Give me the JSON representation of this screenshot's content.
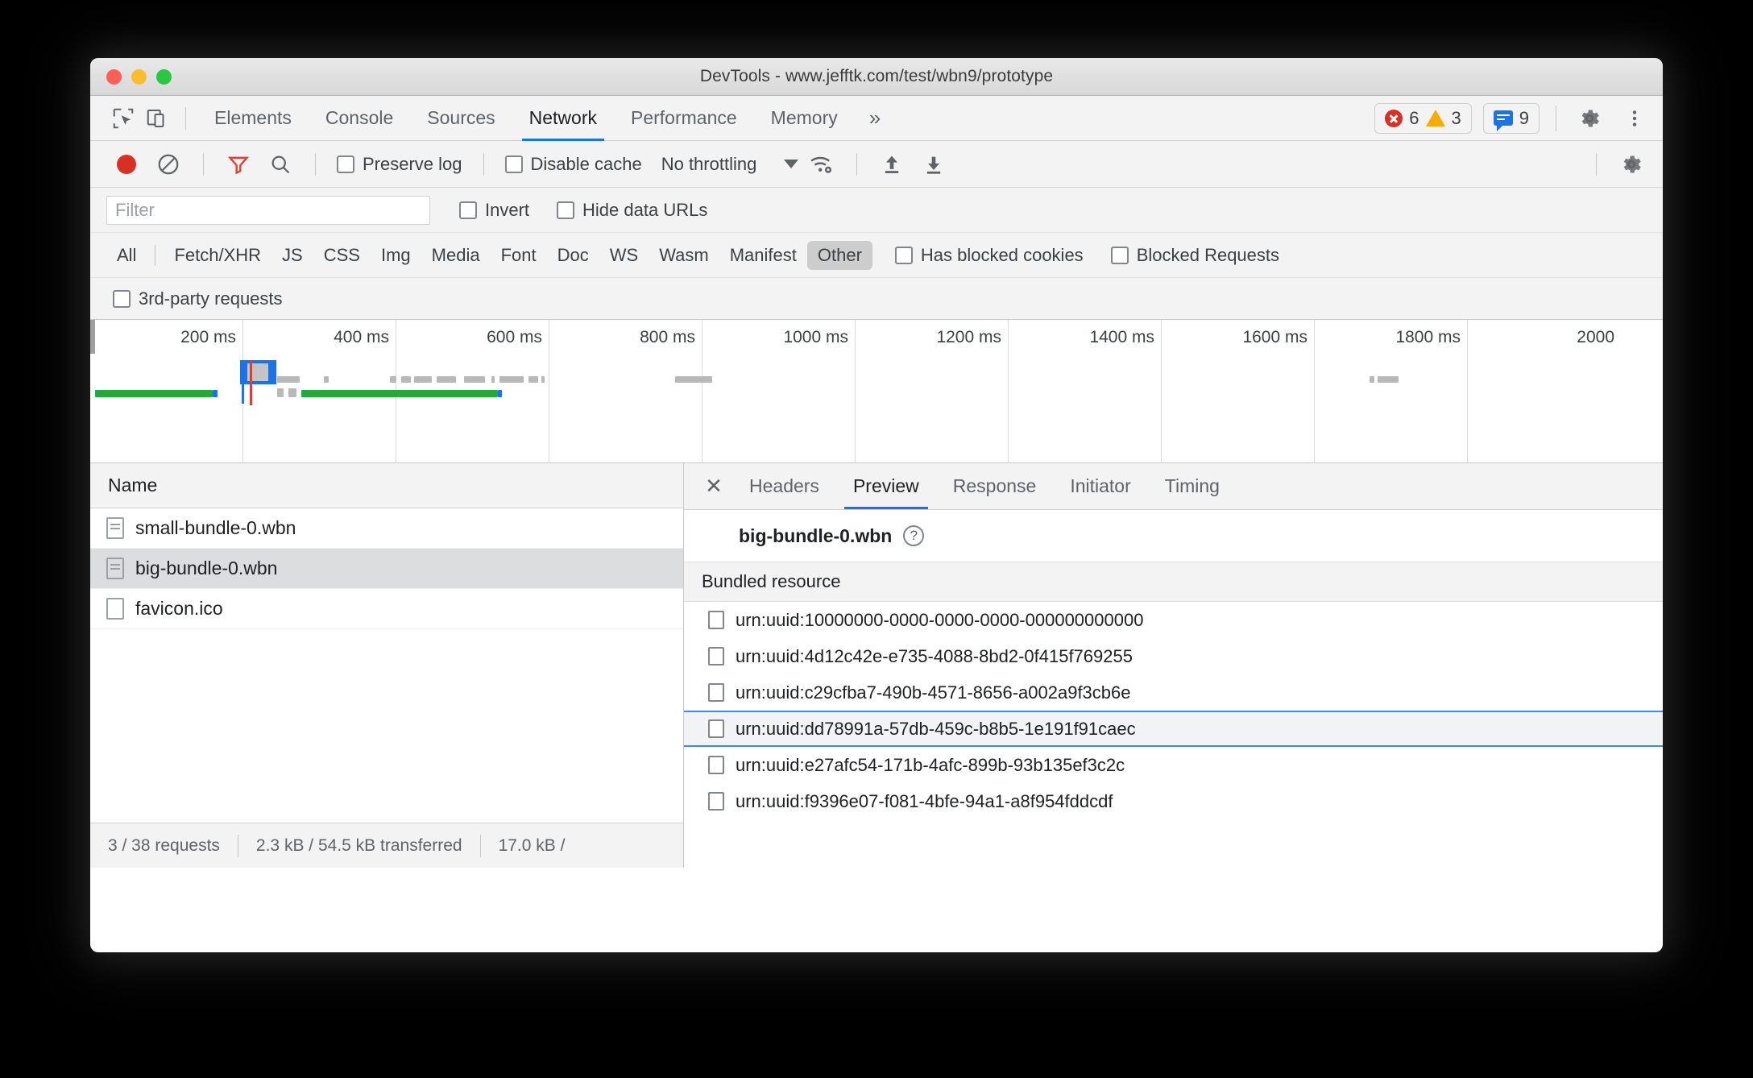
{
  "window": {
    "title": "DevTools - www.jefftk.com/test/wbn9/prototype"
  },
  "main_tabs": [
    {
      "label": "Elements",
      "active": false
    },
    {
      "label": "Console",
      "active": false
    },
    {
      "label": "Sources",
      "active": false
    },
    {
      "label": "Network",
      "active": true
    },
    {
      "label": "Performance",
      "active": false
    },
    {
      "label": "Memory",
      "active": false
    }
  ],
  "main_tabs_overflow": "»",
  "badges": {
    "errors": "6",
    "warnings": "3",
    "messages": "9"
  },
  "icons": {
    "inspect": "inspect-element-icon",
    "device": "device-toolbar-icon",
    "settings": "gear-icon",
    "more": "more-vertical-icon",
    "record": "record-icon",
    "clear": "clear-icon",
    "filter": "filter-funnel-icon",
    "search": "search-icon",
    "network_conditions": "wifi-settings-icon",
    "import_har": "upload-icon",
    "export_har": "download-icon",
    "network_settings": "gear-icon",
    "close": "close-icon",
    "help": "help-circle-icon"
  },
  "net_toolbar": {
    "preserve_log": "Preserve log",
    "disable_cache": "Disable cache",
    "throttling": "No throttling"
  },
  "filter_bar": {
    "filter_placeholder": "Filter",
    "filter_value": "",
    "invert": "Invert",
    "hide_data_urls": "Hide data URLs"
  },
  "type_filters": [
    {
      "label": "All",
      "selected": false
    },
    {
      "label": "Fetch/XHR",
      "selected": false
    },
    {
      "label": "JS",
      "selected": false
    },
    {
      "label": "CSS",
      "selected": false
    },
    {
      "label": "Img",
      "selected": false
    },
    {
      "label": "Media",
      "selected": false
    },
    {
      "label": "Font",
      "selected": false
    },
    {
      "label": "Doc",
      "selected": false
    },
    {
      "label": "WS",
      "selected": false
    },
    {
      "label": "Wasm",
      "selected": false
    },
    {
      "label": "Manifest",
      "selected": false
    },
    {
      "label": "Other",
      "selected": true
    }
  ],
  "type_checkboxes": [
    {
      "label": "Has blocked cookies"
    },
    {
      "label": "Blocked Requests"
    }
  ],
  "third_party": "3rd-party requests",
  "overview": {
    "ticks": [
      "200 ms",
      "400 ms",
      "600 ms",
      "800 ms",
      "1000 ms",
      "1200 ms",
      "1400 ms",
      "1600 ms",
      "1800 ms",
      "2000 "
    ]
  },
  "request_list": {
    "column_header": "Name",
    "rows": [
      {
        "name": "small-bundle-0.wbn",
        "icon": "document-icon",
        "selected": false
      },
      {
        "name": "big-bundle-0.wbn",
        "icon": "document-icon",
        "selected": true
      },
      {
        "name": "favicon.ico",
        "icon": "file-icon",
        "selected": false
      }
    ]
  },
  "status_bar": {
    "requests": "3 / 38 requests",
    "transferred": "2.3 kB / 54.5 kB transferred",
    "resources": "17.0 kB /"
  },
  "detail_tabs": [
    {
      "label": "Headers",
      "active": false
    },
    {
      "label": "Preview",
      "active": true
    },
    {
      "label": "Response",
      "active": false
    },
    {
      "label": "Initiator",
      "active": false
    },
    {
      "label": "Timing",
      "active": false
    }
  ],
  "preview": {
    "title": "big-bundle-0.wbn",
    "help_glyph": "?",
    "column_header": "Bundled resource",
    "resources": [
      {
        "urn": "urn:uuid:10000000-0000-0000-0000-000000000000",
        "focused": false
      },
      {
        "urn": "urn:uuid:4d12c42e-e735-4088-8bd2-0f415f769255",
        "focused": false
      },
      {
        "urn": "urn:uuid:c29cfba7-490b-4571-8656-a002a9f3cb6e",
        "focused": false
      },
      {
        "urn": "urn:uuid:dd78991a-57db-459c-b8b5-1e191f91caec",
        "focused": true
      },
      {
        "urn": "urn:uuid:e27afc54-171b-4afc-899b-93b135ef3c2c",
        "focused": false
      },
      {
        "urn": "urn:uuid:f9396e07-f081-4bfe-94a1-a8f954fddcdf",
        "focused": false
      }
    ]
  },
  "colors": {
    "accent": "#1a73e8",
    "error": "#d93025",
    "warning": "#f9ab00",
    "record": "#d93025",
    "bar_green": "#26a93c"
  }
}
